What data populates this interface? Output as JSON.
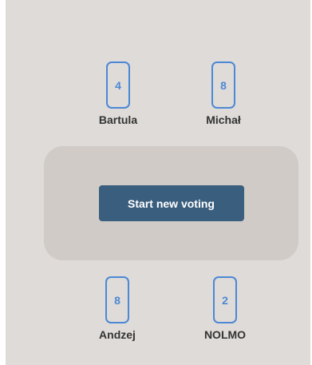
{
  "players_top": [
    {
      "name": "Bartula",
      "card": "4"
    },
    {
      "name": "Michał",
      "card": "8"
    }
  ],
  "players_bottom": [
    {
      "name": "Andzej",
      "card": "8"
    },
    {
      "name": "NOLMO",
      "card": "2"
    }
  ],
  "table": {
    "start_button_label": "Start new voting"
  },
  "colors": {
    "background": "#dedbd8",
    "table": "#d0cbc6",
    "card_accent": "#4c88d6",
    "button": "#3a5e7e",
    "name_text": "#333333"
  }
}
